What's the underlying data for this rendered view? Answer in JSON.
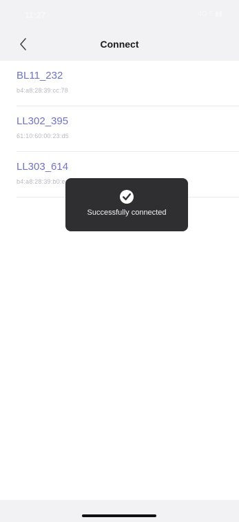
{
  "status_bar": {
    "time": "11:27",
    "right_text": "4G 5 ▮▮"
  },
  "header": {
    "back_icon": "chevron-left-icon",
    "title": "Connect"
  },
  "devices": [
    {
      "name": "BL11_232",
      "mac": "b4:a8:28:39:cc:78"
    },
    {
      "name": "LL302_395",
      "mac": "61:10:60:00:23:d5"
    },
    {
      "name": "LL303_614",
      "mac": "b4:a8:28:39:b0:ed"
    }
  ],
  "toast": {
    "icon": "check-circle-icon",
    "message": "Successfully connected"
  },
  "colors": {
    "accent": "#6f73c4",
    "toast_bg": "#2f2f31",
    "background": "#f2f2f4"
  }
}
